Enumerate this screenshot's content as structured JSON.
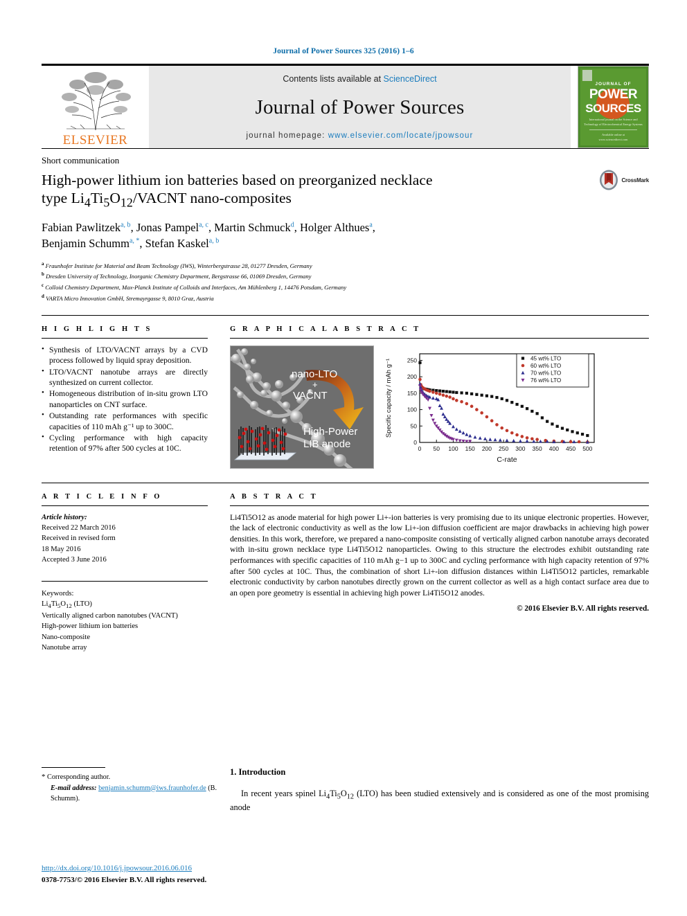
{
  "running_head": "Journal of Power Sources 325 (2016) 1–6",
  "masthead": {
    "contents_prefix": "Contents lists available at ",
    "contents_link": "ScienceDirect",
    "journal_name": "Journal of Power Sources",
    "homepage_prefix": "journal homepage: ",
    "homepage_url": "www.elsevier.com/locate/jpowsour",
    "publisher": "ELSEVIER",
    "cover": {
      "journal_of": "JOURNAL OF",
      "power": "POWER",
      "sources": "SOURCES",
      "subtitle": "International journal on the Science and Technology of Electrochemical Energy Systems",
      "footer": "Available online at www.sciencedirect.com"
    }
  },
  "article": {
    "type": "Short communication",
    "title": "High-power lithium ion batteries based on preorganized necklace type Li4Ti5O12/VACNT nano-composites",
    "title_parts": {
      "line1": "High-power lithium ion batteries based on preorganized necklace",
      "line2_a": "type Li",
      "line2_sub1": "4",
      "line2_b": "Ti",
      "line2_sub2": "5",
      "line2_c": "O",
      "line2_sub3": "12",
      "line2_d": "/VACNT nano-composites"
    },
    "crossmark_label": "CrossMark",
    "authors": [
      {
        "name": "Fabian Pawlitzek",
        "marks": "a, b"
      },
      {
        "name": "Jonas Pampel",
        "marks": "a, c"
      },
      {
        "name": "Martin Schmuck",
        "marks": "d"
      },
      {
        "name": "Holger Althues",
        "marks": "a"
      },
      {
        "name": "Benjamin Schumm",
        "marks": "a, *"
      },
      {
        "name": "Stefan Kaskel",
        "marks": "a, b"
      }
    ],
    "affiliations": [
      {
        "mark": "a",
        "text": "Fraunhofer Institute for Material and Beam Technology (IWS), Winterbergstrasse 28, 01277 Dresden, Germany"
      },
      {
        "mark": "b",
        "text": "Dresden University of Technology, Inorganic Chemistry Department, Bergstrasse 66, 01069 Dresden, Germany"
      },
      {
        "mark": "c",
        "text": "Colloid Chemistry Department, Max-Planck Institute of Colloids and Interfaces, Am Mühlenberg 1, 14476 Potsdam, Germany"
      },
      {
        "mark": "d",
        "text": "VARTA Micro Innovation GmbH, Stremayrgasse 9, 8010 Graz, Austria"
      }
    ]
  },
  "highlights": {
    "heading": "H I G H L I G H T S",
    "items": [
      "Synthesis of LTO/VACNT arrays by a CVD process followed by liquid spray deposition.",
      "LTO/VACNT nanotube arrays are directly synthesized on current collector.",
      "Homogeneous distribution of in-situ grown LTO nanoparticles on CNT surface.",
      "Outstanding rate performances with specific capacities of 110 mAh g⁻¹ up to 300C.",
      "Cycling performance with high capacity retention of 97% after 500 cycles at 10C."
    ]
  },
  "graphical_abstract": {
    "heading": "G R A P H I C A L   A B S T R A C T",
    "image_labels": {
      "top": "nano-LTO",
      "plus": "+",
      "mid": "VACNT",
      "bottom1": "High-Power",
      "bottom2": "LIB anode"
    }
  },
  "chart_data": {
    "type": "scatter",
    "title": "",
    "xlabel": "C-rate",
    "ylabel": "Specific capacity / mAh g⁻¹",
    "xlim": [
      0,
      520
    ],
    "ylim": [
      0,
      270
    ],
    "xticks": [
      0,
      50,
      100,
      150,
      200,
      250,
      300,
      350,
      400,
      450,
      500
    ],
    "yticks": [
      0,
      50,
      100,
      150,
      200,
      250
    ],
    "grid": false,
    "legend_position": "top-right",
    "series": [
      {
        "name": "45 wt% LTO",
        "color": "#111111",
        "marker": "square",
        "x": [
          1,
          3,
          6,
          10,
          15,
          20,
          25,
          30,
          40,
          50,
          60,
          70,
          80,
          90,
          100,
          110,
          125,
          140,
          155,
          170,
          185,
          200,
          215,
          230,
          245,
          260,
          275,
          290,
          305,
          320,
          335,
          350,
          365,
          380,
          395,
          410,
          425,
          440,
          455,
          470,
          485,
          500
        ],
        "y": [
          243,
          175,
          168,
          165,
          163,
          162,
          161,
          160,
          159,
          158,
          157,
          156,
          155,
          154,
          153,
          152,
          151,
          150,
          148,
          146,
          144,
          142,
          140,
          137,
          133,
          128,
          122,
          116,
          110,
          103,
          95,
          88,
          75,
          64,
          56,
          49,
          43,
          38,
          33,
          29,
          25,
          21
        ]
      },
      {
        "name": "60 wt% LTO",
        "color": "#c0392b",
        "marker": "circle",
        "x": [
          1,
          3,
          6,
          10,
          15,
          20,
          25,
          30,
          40,
          50,
          60,
          70,
          80,
          90,
          100,
          110,
          125,
          140,
          155,
          170,
          185,
          200,
          215,
          230,
          245,
          260,
          275,
          290,
          305,
          320,
          335,
          350,
          375,
          400,
          425,
          450,
          475,
          500
        ],
        "y": [
          192,
          176,
          170,
          166,
          163,
          160,
          158,
          156,
          153,
          150,
          147,
          144,
          141,
          138,
          133,
          128,
          124,
          118,
          110,
          100,
          90,
          78,
          66,
          54,
          44,
          36,
          29,
          23,
          18,
          14,
          11,
          9,
          6,
          4,
          3,
          2,
          2,
          1
        ]
      },
      {
        "name": "70 wt% LTO",
        "color": "#2e2f8f",
        "marker": "triangle-up",
        "x": [
          1,
          3,
          6,
          10,
          15,
          20,
          25,
          30,
          40,
          50,
          55,
          60,
          65,
          70,
          75,
          80,
          85,
          90,
          100,
          110,
          120,
          130,
          140,
          150,
          165,
          180,
          195,
          210,
          225,
          240,
          260,
          280,
          300,
          320,
          340,
          360,
          380,
          400,
          430,
          460,
          500
        ],
        "y": [
          178,
          168,
          160,
          152,
          147,
          143,
          140,
          138,
          135,
          133,
          130,
          112,
          104,
          86,
          78,
          70,
          64,
          58,
          48,
          40,
          34,
          29,
          24,
          20,
          16,
          13,
          11,
          9,
          8,
          7,
          6,
          5,
          4,
          4,
          3,
          3,
          3,
          2,
          2,
          2,
          1
        ]
      },
      {
        "name": "76 wt% LTO",
        "color": "#7b2d8e",
        "marker": "triangle-down",
        "x": [
          1,
          3,
          6,
          10,
          15,
          20,
          25,
          30,
          35,
          40,
          45,
          50,
          55,
          60,
          65,
          70,
          75,
          80,
          85,
          90,
          95,
          100,
          110,
          120,
          130,
          140,
          150
        ],
        "y": [
          172,
          160,
          152,
          146,
          140,
          135,
          130,
          104,
          82,
          68,
          58,
          50,
          44,
          38,
          32,
          27,
          23,
          19,
          16,
          13,
          11,
          9,
          7,
          5,
          4,
          3,
          3
        ]
      }
    ]
  },
  "article_info": {
    "heading": "A R T I C L E   I N F O",
    "history_label": "Article history:",
    "history": [
      "Received 22 March 2016",
      "Received in revised form",
      "18 May 2016",
      "Accepted 3 June 2016"
    ],
    "keywords_label": "Keywords:",
    "keywords": [
      "Li4Ti5O12 (LTO)",
      "Vertically aligned carbon nanotubes (VACNT)",
      "High-power lithium ion batteries",
      "Nano-composite",
      "Nanotube array"
    ]
  },
  "abstract": {
    "heading": "A B S T R A C T",
    "body": "Li4Ti5O12 as anode material for high power Li+-ion batteries is very promising due to its unique electronic properties. However, the lack of electronic conductivity as well as the low Li+-ion diffusion coefficient are major drawbacks in achieving high power densities. In this work, therefore, we prepared a nano-composite consisting of vertically aligned carbon nanotube arrays decorated with in-situ grown necklace type Li4Ti5O12 nanoparticles. Owing to this structure the electrodes exhibit outstanding rate performances with specific capacities of 110 mAh g−1 up to 300C and cycling performance with high capacity retention of 97% after 500 cycles at 10C. Thus, the combination of short Li+-ion diffusion distances within Li4Ti5O12 particles, remarkable electronic conductivity by carbon nanotubes directly grown on the current collector as well as a high contact surface area due to an open pore geometry is essential in achieving high power Li4Ti5O12 anodes.",
    "copyright": "© 2016 Elsevier B.V. All rights reserved."
  },
  "footer": {
    "corresponding_marker": "*",
    "corresponding_label": "Corresponding author.",
    "email_label": "E-mail address:",
    "email": "benjamin.schumm@iws.fraunhofer.de",
    "email_person": "(B. Schumm).",
    "doi": "http://dx.doi.org/10.1016/j.jpowsour.2016.06.016",
    "issn_line": "0378-7753/© 2016 Elsevier B.V. All rights reserved."
  },
  "introduction": {
    "heading": "1. Introduction",
    "paragraph": "In recent years spinel Li4Ti5O12 (LTO) has been studied extensively and is considered as one of the most promising anode"
  }
}
